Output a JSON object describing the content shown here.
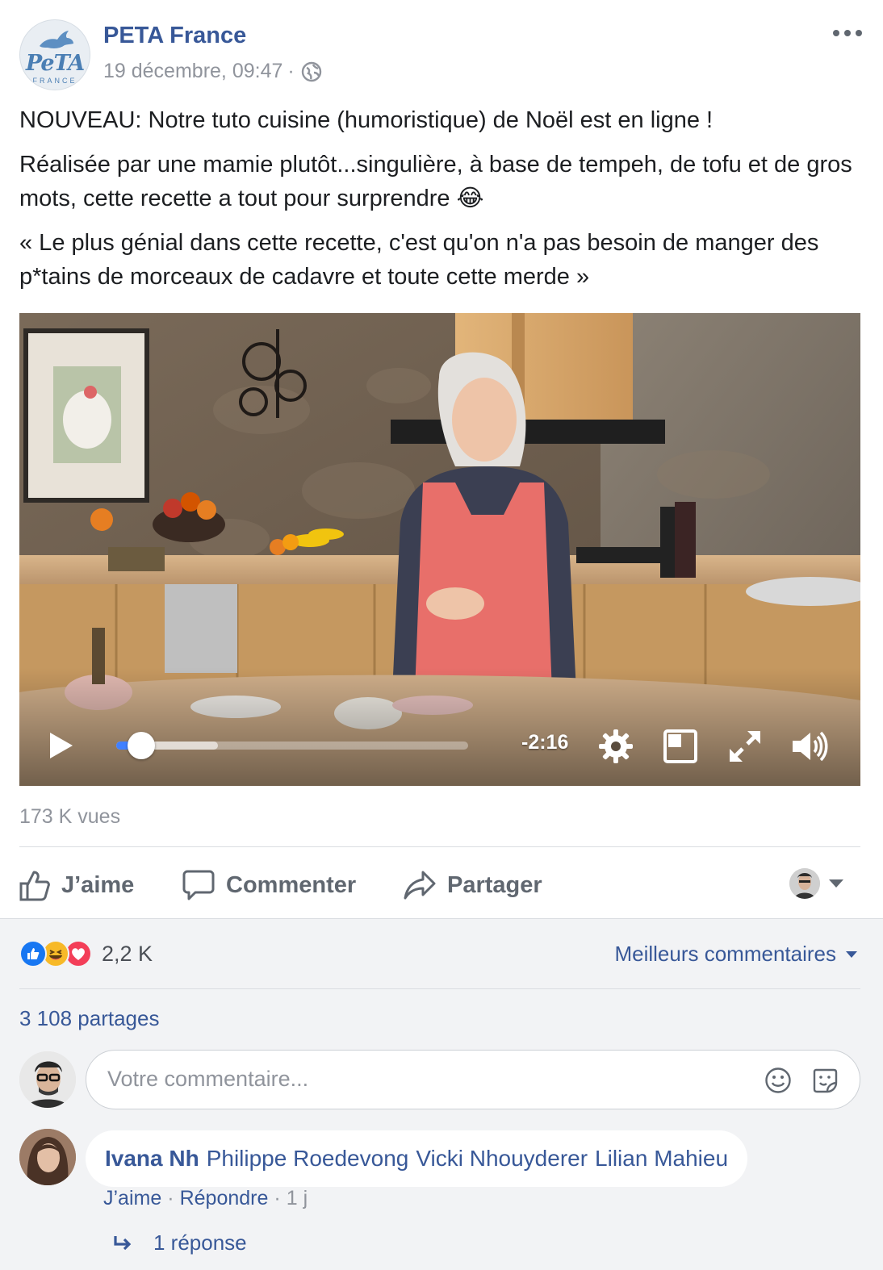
{
  "post": {
    "page_name": "PETA France",
    "logo_text": "PeTA",
    "logo_subtext": "FRANCE",
    "timestamp": "19 décembre, 09:47",
    "meta_separator": "·",
    "audience_icon": "globe-icon",
    "more_icon": "more-horizontal-icon",
    "paragraphs": [
      "NOUVEAU: Notre tuto cuisine (humoristique) de Noël est en ligne !",
      "Réalisée par une mamie plutôt...singulière, à base de tempeh, de tofu et de gros mots, cette recette a tout pour surprendre 😂",
      "« Le plus génial dans cette recette, c'est qu'on n'a pas besoin de manger des p*tains de morceaux de cadavre et toute cette merde »"
    ]
  },
  "video": {
    "time_remaining": "-2:16",
    "progress": 0.07,
    "buffered": 0.29,
    "controls": [
      "play-icon",
      "settings-icon",
      "picture-in-picture-icon",
      "fullscreen-icon",
      "volume-icon"
    ]
  },
  "stats": {
    "views": "173 K vues",
    "reactions_count": "2,2 K",
    "reaction_types": [
      "like",
      "haha",
      "love"
    ],
    "shares": "3 108 partages"
  },
  "actions": {
    "like": "J’aime",
    "comment": "Commenter",
    "share": "Partager"
  },
  "comments": {
    "sort_label": "Meilleurs commentaires",
    "composer_placeholder": "Votre commentaire...",
    "items": [
      {
        "author": "Ivana Nh",
        "mentions": [
          "Philippe Roedevong",
          "Vicki Nhouyderer",
          "Lilian Mahieu"
        ],
        "like_label": "J’aime",
        "reply_label": "Répondre",
        "age": "1 j",
        "separator": "·",
        "replies_label": "1 réponse"
      }
    ]
  },
  "colors": {
    "link": "#385898",
    "secondary_text": "#90949c",
    "progress": "#4080ff",
    "like_reaction": "#1877f2",
    "love_reaction": "#f33e58",
    "haha_reaction": "#f7b928"
  }
}
